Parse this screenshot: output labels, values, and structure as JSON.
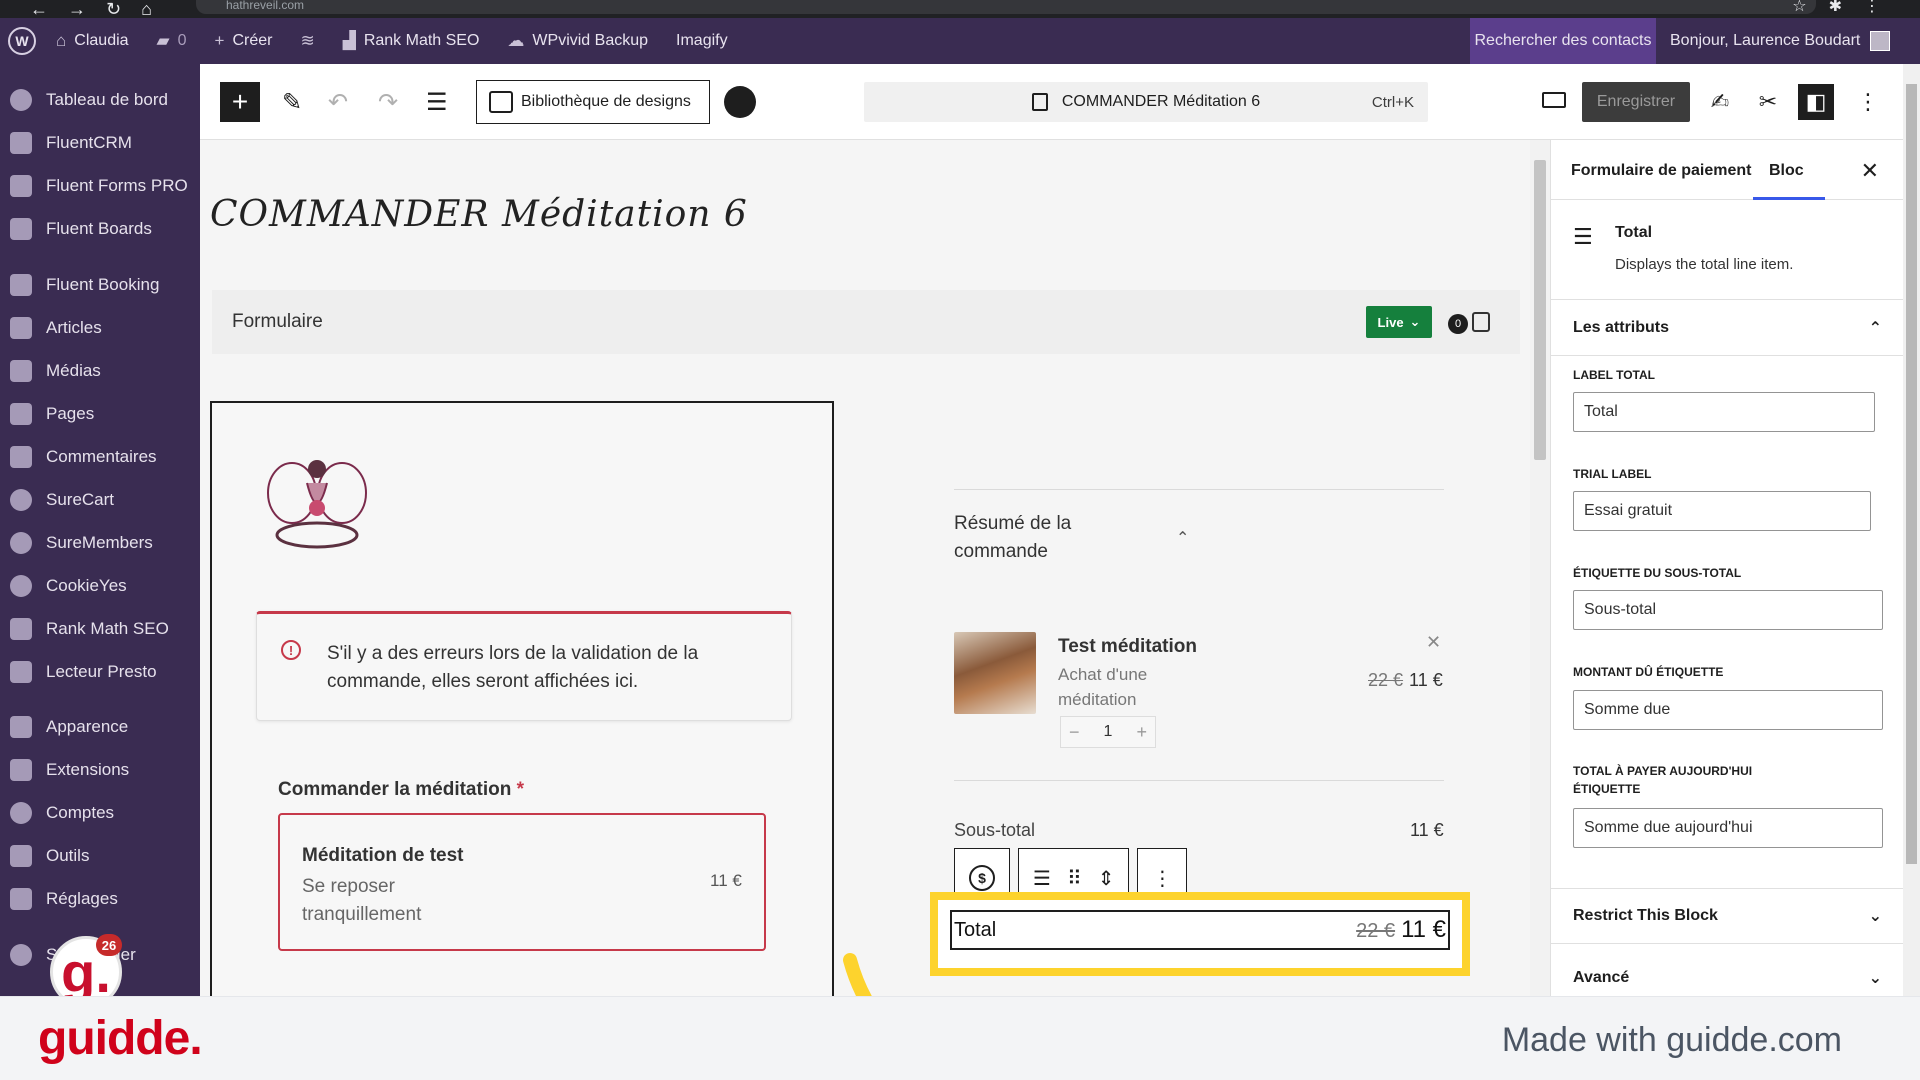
{
  "browser": {
    "url": "hathreveil.com"
  },
  "adminbar": {
    "site_name": "Claudia",
    "comments_count": "0",
    "create_label": "Créer",
    "rankmath_label": "Rank Math SEO",
    "wpvivid_label": "WPvivid Backup",
    "imagify_label": "Imagify",
    "search_contacts": "Rechercher des contacts",
    "greeting": "Bonjour, Laurence Boudart"
  },
  "sidebar": {
    "items": [
      "Tableau de bord",
      "FluentCRM",
      "Fluent Forms PRO",
      "Fluent Boards",
      "Fluent Booking",
      "Articles",
      "Médias",
      "Pages",
      "Commentaires",
      "SureCart",
      "SureMembers",
      "CookieYes",
      "Rank Math SEO",
      "Lecteur Presto",
      "Apparence",
      "Extensions",
      "Comptes",
      "Outils",
      "Réglages",
      "S…zBuilder"
    ],
    "notification_badge": "26"
  },
  "toolbar": {
    "designs_label": "Bibliothèque de designs",
    "doc_title": "COMMANDER Méditation 6",
    "shortcut": "Ctrl+K",
    "save_label": "Enregistrer"
  },
  "canvas": {
    "page_title": "COMMANDER Méditation 6",
    "form_label": "Formulaire",
    "live_label": "Live",
    "cart_count": "0",
    "error_message": "S'il y a des erreurs lors de la validation de la commande, elles seront affichées ici.",
    "order_label": "Commander la méditation",
    "required_mark": "*",
    "product": {
      "name": "Méditation de test",
      "description": "Se reposer tranquillement",
      "price": "11 €"
    },
    "summary": {
      "title": "Résumé de la commande",
      "item_name": "Test méditation",
      "item_desc": "Achat d'une méditation",
      "old_price": "22 €",
      "price": "11 €",
      "quantity": "1",
      "subtotal_label": "Sous-total",
      "subtotal_value": "11 €",
      "total_label": "Total",
      "total_old": "22 €",
      "total_value": "11 €"
    }
  },
  "inspector": {
    "tab_form": "Formulaire de paiement",
    "tab_block": "Bloc",
    "block_name": "Total",
    "block_desc": "Displays the total line item.",
    "attributes_title": "Les attributs",
    "fields": [
      {
        "label": "LABEL TOTAL",
        "value": "Total"
      },
      {
        "label": "TRIAL LABEL",
        "value": "Essai gratuit"
      },
      {
        "label": "ÉTIQUETTE DU SOUS-TOTAL",
        "value": "Sous-total"
      },
      {
        "label": "MONTANT DÛ ÉTIQUETTE",
        "value": "Somme due"
      },
      {
        "label": "TOTAL À PAYER AUJOURD'HUI ÉTIQUETTE",
        "value": "Somme due aujourd'hui"
      }
    ],
    "restrict_title": "Restrict This Block",
    "advanced_title": "Avancé"
  },
  "footer": {
    "brand": "guidde.",
    "made_with": "Made with guidde.com"
  },
  "colors": {
    "highlight": "#fdd32d",
    "admin_bg": "#3a2c52",
    "brand_red": "#d0021b"
  }
}
